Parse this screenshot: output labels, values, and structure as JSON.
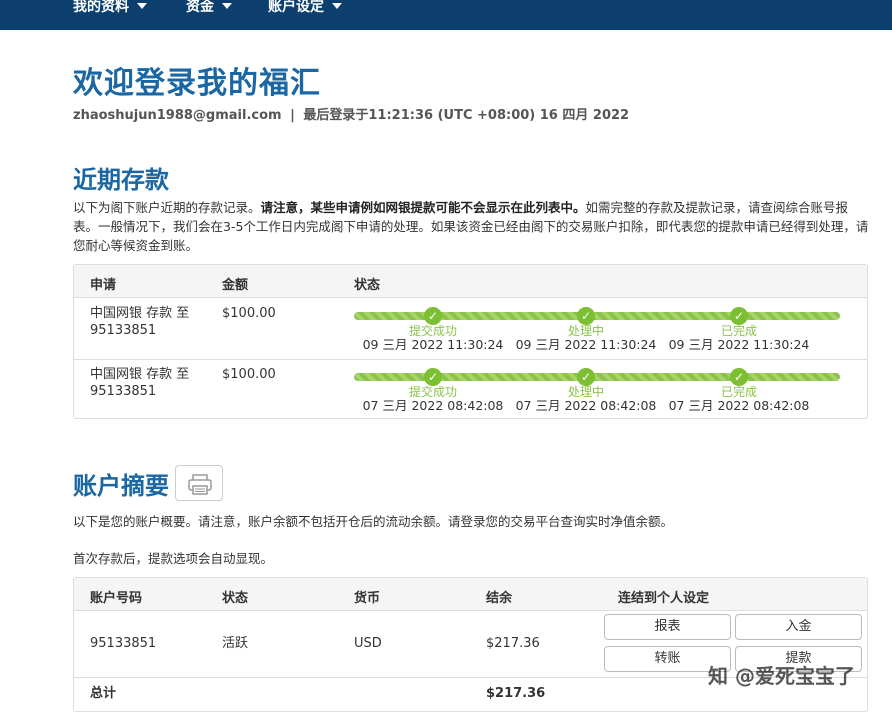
{
  "nav": {
    "items": [
      {
        "label": "我的资料"
      },
      {
        "label": "资金"
      },
      {
        "label": "账户设定"
      }
    ]
  },
  "welcome": {
    "title": "欢迎登录我的福汇",
    "email": "zhaoshujun1988@gmail.com",
    "separator": "|",
    "last_login": "最后登录于11:21:36 (UTC +08:00) 16 四月 2022"
  },
  "deposits": {
    "title": "近期存款",
    "desc_1": "以下为阁下账户近期的存款记录。",
    "desc_bold": "请注意，某些申请例如网银提款可能不会显示在此列表中。",
    "desc_2": "如需完整的存款及提款记录，请查阅综合账号报表。一般情况下，我们会在3-5个工作日内完成阁下申请的处理。如果该资金已经由阁下的交易账户扣除，即代表您的提款申请已经得到处理，请您耐心等候资金到账。",
    "headers": [
      "申请",
      "金额",
      "状态"
    ],
    "rows": [
      {
        "request": "中国网银 存款 至 95133851",
        "amount": "$100.00",
        "steps": [
          {
            "label": "提交成功",
            "time": "09 三月 2022 11:30:24"
          },
          {
            "label": "处理中",
            "time": "09 三月 2022 11:30:24"
          },
          {
            "label": "已完成",
            "time": "09 三月 2022 11:30:24"
          }
        ]
      },
      {
        "request": "中国网银 存款 至 95133851",
        "amount": "$100.00",
        "steps": [
          {
            "label": "提交成功",
            "time": "07 三月 2022 08:42:08"
          },
          {
            "label": "处理中",
            "time": "07 三月 2022 08:42:08"
          },
          {
            "label": "已完成",
            "time": "07 三月 2022 08:42:08"
          }
        ]
      }
    ],
    "check_glyph": "✓",
    "progress_color": "#8bc34a"
  },
  "summary": {
    "title": "账户摘要",
    "desc_1": "以下是您的账户概要。请注意，账户余额不包括开仓后的流动余额。请登录您的交易平台查询实时净值余额。",
    "desc_2": "首次存款后，提款选项会自动显现。",
    "headers": [
      "账户号码",
      "状态",
      "货币",
      "结余",
      "连结到个人设定"
    ],
    "row": {
      "account": "95133851",
      "status": "活跃",
      "currency": "USD",
      "balance": "$217.36"
    },
    "buttons": {
      "statement": "报表",
      "deposit": "入金",
      "transfer": "转账",
      "withdraw": "提款"
    },
    "total_label": "总计",
    "total_value": "$217.36"
  },
  "watermark": "知 @爱死宝宝了",
  "colors": {
    "nav_bg": "#0c3f6e",
    "heading": "#1a67a3",
    "success": "#7cbf33"
  },
  "icons": {
    "caret": "chevron-down-icon",
    "print": "printer-icon",
    "check": "check-icon"
  }
}
